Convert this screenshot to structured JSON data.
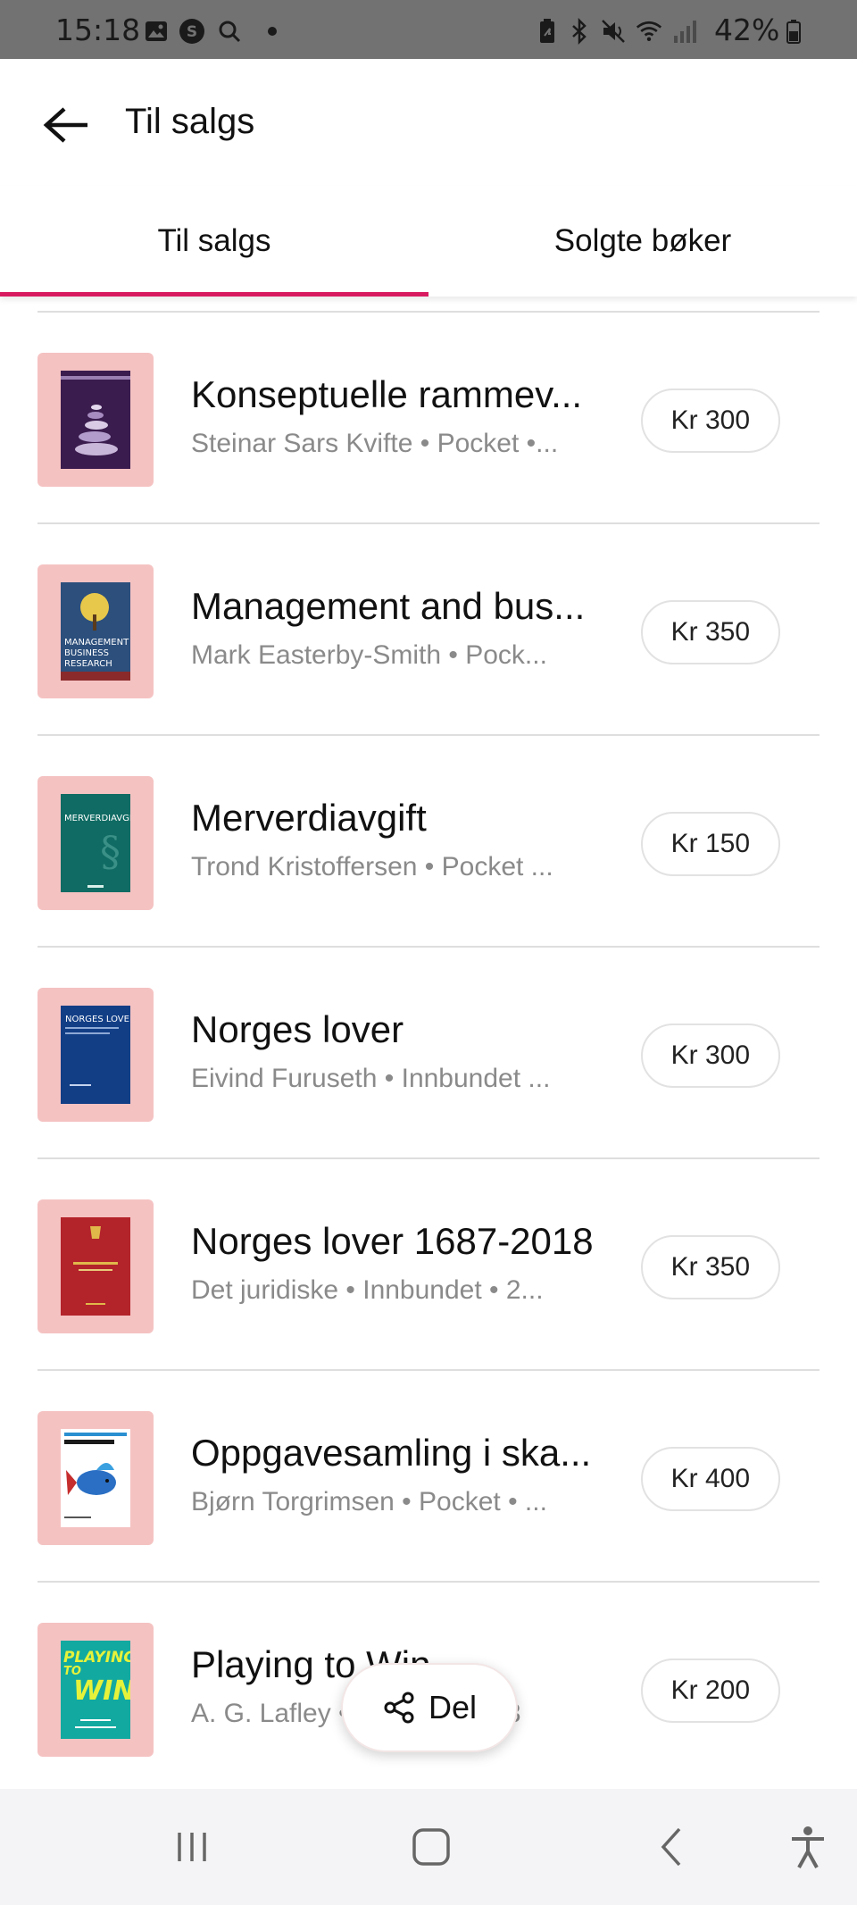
{
  "status_bar": {
    "time": "15:18",
    "battery_percent": "42%",
    "icons": [
      "image-icon",
      "s-app-icon",
      "search-icon",
      "dot-icon",
      "battery-saver-icon",
      "bluetooth-icon",
      "mute-icon",
      "wifi-icon",
      "signal-icon",
      "battery-icon"
    ]
  },
  "app_bar": {
    "title": "Til salgs",
    "back_icon": "arrow-left-icon"
  },
  "tabs": [
    {
      "label": "Til salgs",
      "selected": true
    },
    {
      "label": "Solgte bøker",
      "selected": false
    }
  ],
  "colors": {
    "accent": "#d81b60",
    "thumb_bg": "#f5c2c2",
    "meta_text": "#8a8a8a"
  },
  "books": [
    {
      "title": "Konseptuelle rammev...",
      "meta": "Steinar Sars Kvifte • Pocket •...",
      "price": "Kr 300",
      "cover": "purple-stones-cover"
    },
    {
      "title": "Management and bus...",
      "meta": "Mark Easterby-Smith • Pock...",
      "price": "Kr 350",
      "cover": "blue-tree-cover"
    },
    {
      "title": "Merverdiavgift",
      "meta": "Trond Kristoffersen • Pocket ...",
      "price": "Kr 150",
      "cover": "teal-cover"
    },
    {
      "title": "Norges lover",
      "meta": "Eivind Furuseth • Innbundet ...",
      "price": "Kr 300",
      "cover": "navy-cover"
    },
    {
      "title": "Norges lover 1687-2018",
      "meta": "Det juridiske • Innbundet • 2...",
      "price": "Kr 350",
      "cover": "red-cover"
    },
    {
      "title": "Oppgavesamling i ska...",
      "meta": "Bjørn Torgrimsen • Pocket • ...",
      "price": "Kr 400",
      "cover": "fish-cover"
    },
    {
      "title": "Playing to Win",
      "meta": "A. G. Lafley • Pocket • 2013",
      "price": "Kr 200",
      "cover": "playing-to-win-cover"
    }
  ],
  "share": {
    "label": "Del",
    "icon": "share-icon"
  },
  "nav_bar": {
    "icons": [
      "recent-apps-icon",
      "home-icon",
      "back-icon",
      "accessibility-icon"
    ]
  }
}
